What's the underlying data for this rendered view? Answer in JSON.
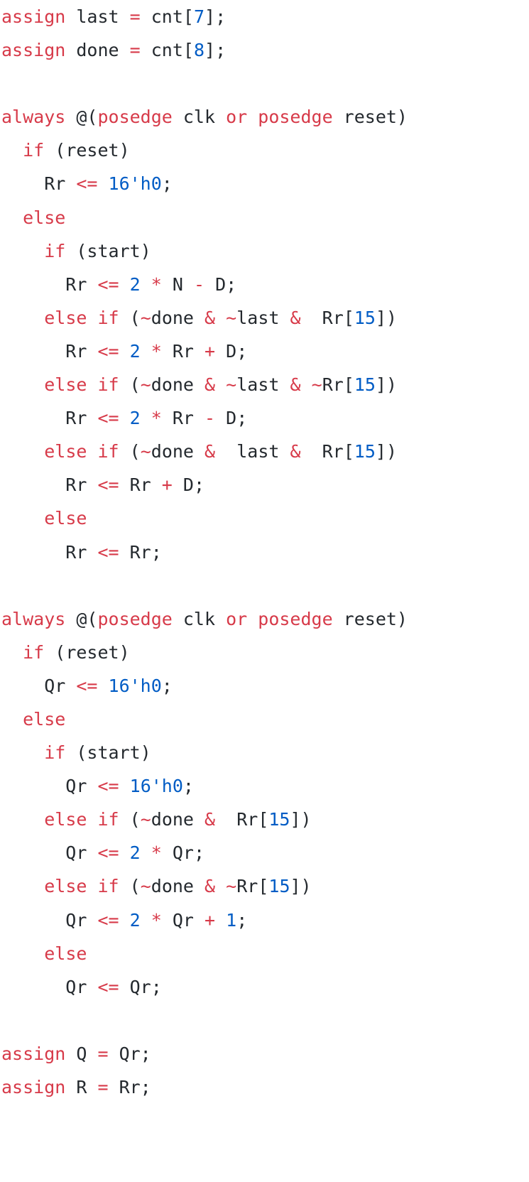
{
  "code": {
    "language": "verilog",
    "colors": {
      "keyword": "#d73a49",
      "number": "#005cc5",
      "text": "#24292e",
      "background": "#ffffff"
    },
    "lines": [
      [
        [
          "kw",
          "assign"
        ],
        [
          "id",
          " last "
        ],
        [
          "kw",
          "="
        ],
        [
          "id",
          " cnt["
        ],
        [
          "num",
          "7"
        ],
        [
          "id",
          "];"
        ]
      ],
      [
        [
          "kw",
          "assign"
        ],
        [
          "id",
          " done "
        ],
        [
          "kw",
          "="
        ],
        [
          "id",
          " cnt["
        ],
        [
          "num",
          "8"
        ],
        [
          "id",
          "];"
        ]
      ],
      [],
      [
        [
          "kw",
          "always"
        ],
        [
          "id",
          " @("
        ],
        [
          "kw",
          "posedge"
        ],
        [
          "id",
          " clk "
        ],
        [
          "kw",
          "or"
        ],
        [
          "id",
          " "
        ],
        [
          "kw",
          "posedge"
        ],
        [
          "id",
          " reset)"
        ]
      ],
      [
        [
          "id",
          "  "
        ],
        [
          "kw",
          "if"
        ],
        [
          "id",
          " (reset)"
        ]
      ],
      [
        [
          "id",
          "    Rr "
        ],
        [
          "kw",
          "<="
        ],
        [
          "id",
          " "
        ],
        [
          "num",
          "16'h0"
        ],
        [
          "id",
          ";"
        ]
      ],
      [
        [
          "id",
          "  "
        ],
        [
          "kw",
          "else"
        ]
      ],
      [
        [
          "id",
          "    "
        ],
        [
          "kw",
          "if"
        ],
        [
          "id",
          " (start)"
        ]
      ],
      [
        [
          "id",
          "      Rr "
        ],
        [
          "kw",
          "<="
        ],
        [
          "id",
          " "
        ],
        [
          "num",
          "2"
        ],
        [
          "id",
          " "
        ],
        [
          "kw",
          "*"
        ],
        [
          "id",
          " N "
        ],
        [
          "kw",
          "-"
        ],
        [
          "id",
          " D;"
        ]
      ],
      [
        [
          "id",
          "    "
        ],
        [
          "kw",
          "else"
        ],
        [
          "id",
          " "
        ],
        [
          "kw",
          "if"
        ],
        [
          "id",
          " ("
        ],
        [
          "kw",
          "~"
        ],
        [
          "id",
          "done "
        ],
        [
          "kw",
          "&"
        ],
        [
          "id",
          " "
        ],
        [
          "kw",
          "~"
        ],
        [
          "id",
          "last "
        ],
        [
          "kw",
          "&"
        ],
        [
          "id",
          "  Rr["
        ],
        [
          "num",
          "15"
        ],
        [
          "id",
          "])"
        ]
      ],
      [
        [
          "id",
          "      Rr "
        ],
        [
          "kw",
          "<="
        ],
        [
          "id",
          " "
        ],
        [
          "num",
          "2"
        ],
        [
          "id",
          " "
        ],
        [
          "kw",
          "*"
        ],
        [
          "id",
          " Rr "
        ],
        [
          "kw",
          "+"
        ],
        [
          "id",
          " D;"
        ]
      ],
      [
        [
          "id",
          "    "
        ],
        [
          "kw",
          "else"
        ],
        [
          "id",
          " "
        ],
        [
          "kw",
          "if"
        ],
        [
          "id",
          " ("
        ],
        [
          "kw",
          "~"
        ],
        [
          "id",
          "done "
        ],
        [
          "kw",
          "&"
        ],
        [
          "id",
          " "
        ],
        [
          "kw",
          "~"
        ],
        [
          "id",
          "last "
        ],
        [
          "kw",
          "&"
        ],
        [
          "id",
          " "
        ],
        [
          "kw",
          "~"
        ],
        [
          "id",
          "Rr["
        ],
        [
          "num",
          "15"
        ],
        [
          "id",
          "])"
        ]
      ],
      [
        [
          "id",
          "      Rr "
        ],
        [
          "kw",
          "<="
        ],
        [
          "id",
          " "
        ],
        [
          "num",
          "2"
        ],
        [
          "id",
          " "
        ],
        [
          "kw",
          "*"
        ],
        [
          "id",
          " Rr "
        ],
        [
          "kw",
          "-"
        ],
        [
          "id",
          " D;"
        ]
      ],
      [
        [
          "id",
          "    "
        ],
        [
          "kw",
          "else"
        ],
        [
          "id",
          " "
        ],
        [
          "kw",
          "if"
        ],
        [
          "id",
          " ("
        ],
        [
          "kw",
          "~"
        ],
        [
          "id",
          "done "
        ],
        [
          "kw",
          "&"
        ],
        [
          "id",
          "  last "
        ],
        [
          "kw",
          "&"
        ],
        [
          "id",
          "  Rr["
        ],
        [
          "num",
          "15"
        ],
        [
          "id",
          "])"
        ]
      ],
      [
        [
          "id",
          "      Rr "
        ],
        [
          "kw",
          "<="
        ],
        [
          "id",
          " Rr "
        ],
        [
          "kw",
          "+"
        ],
        [
          "id",
          " D;"
        ]
      ],
      [
        [
          "id",
          "    "
        ],
        [
          "kw",
          "else"
        ]
      ],
      [
        [
          "id",
          "      Rr "
        ],
        [
          "kw",
          "<="
        ],
        [
          "id",
          " Rr;"
        ]
      ],
      [],
      [
        [
          "kw",
          "always"
        ],
        [
          "id",
          " @("
        ],
        [
          "kw",
          "posedge"
        ],
        [
          "id",
          " clk "
        ],
        [
          "kw",
          "or"
        ],
        [
          "id",
          " "
        ],
        [
          "kw",
          "posedge"
        ],
        [
          "id",
          " reset)"
        ]
      ],
      [
        [
          "id",
          "  "
        ],
        [
          "kw",
          "if"
        ],
        [
          "id",
          " (reset)"
        ]
      ],
      [
        [
          "id",
          "    Qr "
        ],
        [
          "kw",
          "<="
        ],
        [
          "id",
          " "
        ],
        [
          "num",
          "16'h0"
        ],
        [
          "id",
          ";"
        ]
      ],
      [
        [
          "id",
          "  "
        ],
        [
          "kw",
          "else"
        ]
      ],
      [
        [
          "id",
          "    "
        ],
        [
          "kw",
          "if"
        ],
        [
          "id",
          " (start)"
        ]
      ],
      [
        [
          "id",
          "      Qr "
        ],
        [
          "kw",
          "<="
        ],
        [
          "id",
          " "
        ],
        [
          "num",
          "16'h0"
        ],
        [
          "id",
          ";"
        ]
      ],
      [
        [
          "id",
          "    "
        ],
        [
          "kw",
          "else"
        ],
        [
          "id",
          " "
        ],
        [
          "kw",
          "if"
        ],
        [
          "id",
          " ("
        ],
        [
          "kw",
          "~"
        ],
        [
          "id",
          "done "
        ],
        [
          "kw",
          "&"
        ],
        [
          "id",
          "  Rr["
        ],
        [
          "num",
          "15"
        ],
        [
          "id",
          "])"
        ]
      ],
      [
        [
          "id",
          "      Qr "
        ],
        [
          "kw",
          "<="
        ],
        [
          "id",
          " "
        ],
        [
          "num",
          "2"
        ],
        [
          "id",
          " "
        ],
        [
          "kw",
          "*"
        ],
        [
          "id",
          " Qr;"
        ]
      ],
      [
        [
          "id",
          "    "
        ],
        [
          "kw",
          "else"
        ],
        [
          "id",
          " "
        ],
        [
          "kw",
          "if"
        ],
        [
          "id",
          " ("
        ],
        [
          "kw",
          "~"
        ],
        [
          "id",
          "done "
        ],
        [
          "kw",
          "&"
        ],
        [
          "id",
          " "
        ],
        [
          "kw",
          "~"
        ],
        [
          "id",
          "Rr["
        ],
        [
          "num",
          "15"
        ],
        [
          "id",
          "])"
        ]
      ],
      [
        [
          "id",
          "      Qr "
        ],
        [
          "kw",
          "<="
        ],
        [
          "id",
          " "
        ],
        [
          "num",
          "2"
        ],
        [
          "id",
          " "
        ],
        [
          "kw",
          "*"
        ],
        [
          "id",
          " Qr "
        ],
        [
          "kw",
          "+"
        ],
        [
          "id",
          " "
        ],
        [
          "num",
          "1"
        ],
        [
          "id",
          ";"
        ]
      ],
      [
        [
          "id",
          "    "
        ],
        [
          "kw",
          "else"
        ]
      ],
      [
        [
          "id",
          "      Qr "
        ],
        [
          "kw",
          "<="
        ],
        [
          "id",
          " Qr;"
        ]
      ],
      [],
      [
        [
          "kw",
          "assign"
        ],
        [
          "id",
          " Q "
        ],
        [
          "kw",
          "="
        ],
        [
          "id",
          " Qr;"
        ]
      ],
      [
        [
          "kw",
          "assign"
        ],
        [
          "id",
          " R "
        ],
        [
          "kw",
          "="
        ],
        [
          "id",
          " Rr;"
        ]
      ]
    ]
  }
}
